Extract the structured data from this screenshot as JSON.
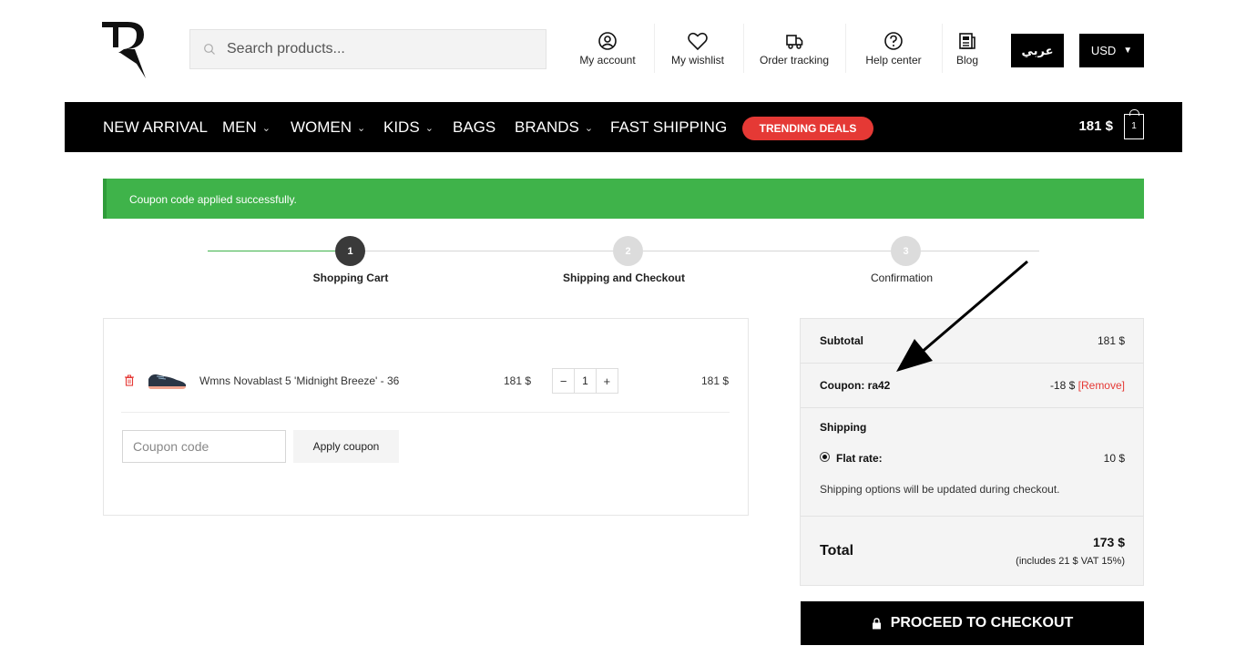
{
  "header": {
    "search_placeholder": "Search products...",
    "links": [
      {
        "label": "My account",
        "icon": "account-icon"
      },
      {
        "label": "My wishlist",
        "icon": "heart-icon"
      },
      {
        "label": "Order tracking",
        "icon": "truck-icon"
      },
      {
        "label": "Help center",
        "icon": "help-icon"
      },
      {
        "label": "Blog",
        "icon": "newspaper-icon"
      }
    ],
    "language_label": "عربي",
    "currency_label": "USD",
    "currency_caret": "▼"
  },
  "nav": {
    "items": [
      {
        "label": "NEW ARRIVAL",
        "caret": ""
      },
      {
        "label": "MEN",
        "caret": "⌄"
      },
      {
        "label": "WOMEN",
        "caret": "⌄"
      },
      {
        "label": "KIDS",
        "caret": "⌄"
      },
      {
        "label": "BAGS",
        "caret": ""
      },
      {
        "label": "BRANDS",
        "caret": "⌄"
      },
      {
        "label": "FAST SHIPPING",
        "caret": ""
      }
    ],
    "trending_label": "TRENDING DEALS",
    "cart_total": "181 $",
    "cart_count": "1"
  },
  "notice": {
    "message": "Coupon code applied successfully.",
    "color": "#3fb34a"
  },
  "steps": [
    {
      "number": "1",
      "label": "Shopping Cart",
      "active": true
    },
    {
      "number": "2",
      "label": "Shipping and Checkout",
      "active": false
    },
    {
      "number": "3",
      "label": "Confirmation",
      "active": false
    }
  ],
  "cart": {
    "item": {
      "name": "Wmns Novablast 5 'Midnight Breeze' - 36",
      "price": "181 $",
      "quantity": "1",
      "qty_minus": "−",
      "qty_plus": "+",
      "subtotal": "181 $"
    },
    "coupon_placeholder": "Coupon code",
    "apply_label": "Apply coupon"
  },
  "totals": {
    "subtotal_label": "Subtotal",
    "subtotal_value": "181 $",
    "coupon_label": "Coupon: ra42",
    "coupon_value": "-18 $",
    "remove_label": "[Remove]",
    "shipping_label": "Shipping",
    "flat_rate_label": "Flat rate:",
    "flat_rate_value": "10 $",
    "shipping_note": "Shipping options will be updated during checkout.",
    "total_label": "Total",
    "total_value": "173 $",
    "vat_note": "(includes 21 $ VAT 15%)",
    "proceed_label": "PROCEED TO CHECKOUT"
  },
  "colors": {
    "accent_red": "#e53935",
    "success_green": "#3fb34a",
    "nav_black": "#000000"
  }
}
